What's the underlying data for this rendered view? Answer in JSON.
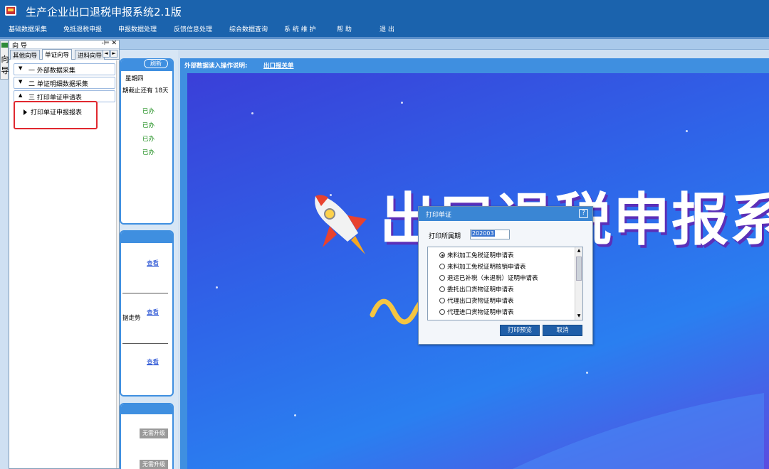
{
  "app": {
    "title": "生产企业出口退税申报系统2.1版"
  },
  "menu": [
    "基础数据采集",
    "免抵退税申报",
    "申报数据处理",
    "反馈信息处理",
    "综合数据查询",
    "系 统 维 护",
    "帮  助",
    "退  出"
  ],
  "sidetab": {
    "chars": [
      "向",
      "导"
    ]
  },
  "guide": {
    "title": "向 导",
    "btns": "-⊨ ✕",
    "tabs": [
      "其他向导",
      "单证向导",
      "进料向导"
    ],
    "scroll_left": "◄",
    "scroll_right": "►",
    "tree": [
      {
        "arrow": "▼",
        "label": "一  外部数据采集"
      },
      {
        "arrow": "▼",
        "label": "二  单证明细数据采集"
      },
      {
        "arrow": "▲",
        "label": "三  打印单证申请表"
      }
    ],
    "child": "打印单证申报报表"
  },
  "mid": {
    "refresh": "刷新",
    "weekday": "星期四",
    "deadline": "期截止还有 18天",
    "done": [
      "已办",
      "已办",
      "已办",
      "已办"
    ],
    "view": [
      "查看",
      "查看",
      "查看"
    ],
    "trend": "据走势",
    "no_upgrade": [
      "无需升级",
      "无需升级"
    ]
  },
  "content": {
    "head_label": "外部数据读入操作说明:",
    "head_link": "出口报关单",
    "banner": "出口退税申报系统"
  },
  "dialog": {
    "title": "打印单证",
    "help": "?",
    "period_label": "打印所属期",
    "period_value": "202003",
    "options": [
      "来料加工免税证明申请表",
      "来料加工免税证明核销申请表",
      "退运已补税（未退税）证明申请表",
      "委托出口货物证明申请表",
      "代理出口货物证明申请表",
      "代理进口货物证明申请表"
    ],
    "selected_index": 0,
    "scroll_up": "▲",
    "scroll_down": "▼",
    "preview_btn": "打印预览",
    "cancel_btn": "取消"
  },
  "colors": {
    "titlebar": "#1b63ad",
    "accent": "#3f8fe0",
    "highlight": "#e0282f",
    "done": "#1a8c1a"
  }
}
